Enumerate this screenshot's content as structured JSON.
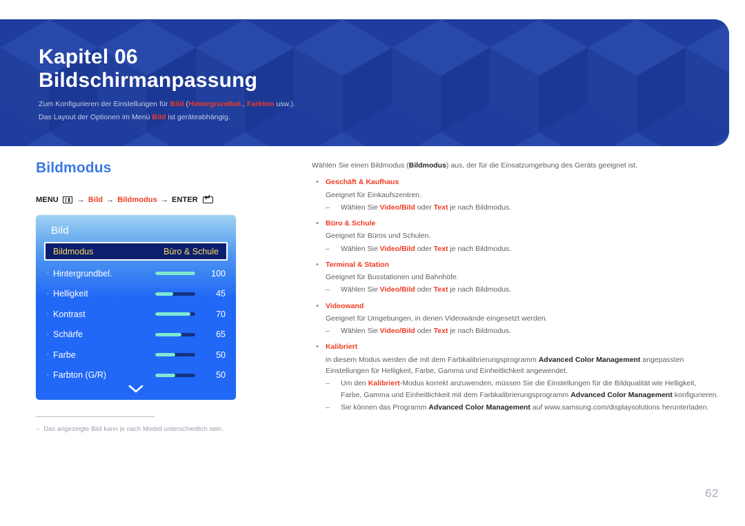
{
  "banner": {
    "chapter_label": "Kapitel 06",
    "chapter_title": "Bildschirmanpassung",
    "sub_line1_a": "Zum Konfigurieren der Einstellungen für ",
    "sub_line1_hl1": "Bild",
    "sub_line1_b": " (",
    "sub_line1_hl2": "Hintergrundbel.",
    "sub_line1_c": ", ",
    "sub_line1_hl3": "Farbton",
    "sub_line1_d": " usw.).",
    "sub_line2_a": "Das Layout der Optionen im Menü ",
    "sub_line2_hl1": "Bild",
    "sub_line2_b": " ist geräteabhängig.",
    "bg_color": "#1f3e9e",
    "accent_color": "#ef3b24"
  },
  "left": {
    "section_title": "Bildmodus",
    "menu_path": {
      "menu_label": "MENU",
      "arrow": "→",
      "item1": "Bild",
      "item2": "Bildmodus",
      "enter_label": "ENTER",
      "menu_icon": "menu-grid-icon",
      "enter_icon": "enter-key-icon"
    },
    "osd": {
      "title": "Bild",
      "selected": {
        "label": "Bildmodus",
        "value": "Büro & Schule"
      },
      "rows": [
        {
          "label": "Hintergrundbel.",
          "value": "100",
          "fill_pct": 100
        },
        {
          "label": "Helligkeit",
          "value": "45",
          "fill_pct": 45
        },
        {
          "label": "Kontrast",
          "value": "70",
          "fill_pct": 88
        },
        {
          "label": "Schärfe",
          "value": "65",
          "fill_pct": 65
        },
        {
          "label": "Farbe",
          "value": "50",
          "fill_pct": 50
        },
        {
          "label": "Farbton (G/R)",
          "value": "50",
          "fill_pct": 50
        }
      ],
      "scroll_icon": "chevron-down-icon",
      "slider_fill_color": "#7ee9d2",
      "slider_track_color": "#123483"
    },
    "footnote": {
      "dash": "–",
      "text": "Das angezeigte Bild kann je nach Modell unterschiedlich sein."
    }
  },
  "right": {
    "intro_a": "Wählen Sie einen Bildmodus (",
    "intro_hl": "Bildmodus",
    "intro_b": ") aus, der für die Einsatzumgebung des Geräts geeignet ist.",
    "bullet_char": "•",
    "dash_char": "–",
    "modes": [
      {
        "name": "Geschäft & Kaufhaus",
        "desc": "Geeignet für Einkaufszentren.",
        "sub_a": "Wählen Sie ",
        "sub_hl1": "Video/Bild",
        "sub_b": " oder ",
        "sub_hl2": "Text",
        "sub_c": " je nach Bildmodus."
      },
      {
        "name": "Büro & Schule",
        "desc": "Geeignet für Büros und Schulen.",
        "sub_a": "Wählen Sie ",
        "sub_hl1": "Video/Bild",
        "sub_b": " oder ",
        "sub_hl2": "Text",
        "sub_c": " je nach Bildmodus."
      },
      {
        "name": "Terminal & Station",
        "desc": "Geeignet für Busstationen und Bahnhöfe.",
        "sub_a": "Wählen Sie ",
        "sub_hl1": "Video/Bild",
        "sub_b": " oder ",
        "sub_hl2": "Text",
        "sub_c": " je nach Bildmodus."
      },
      {
        "name": "Videowand",
        "desc": "Geeignet für Umgebungen, in denen Videowände eingesetzt werden.",
        "sub_a": "Wählen Sie ",
        "sub_hl1": "Video/Bild",
        "sub_b": " oder ",
        "sub_hl2": "Text",
        "sub_c": " je nach Bildmodus."
      }
    ],
    "kalibriert": {
      "name": "Kalibriert",
      "desc_a": "in diesem Modus werden die mit dem Farbkalibrierungsprogramm ",
      "desc_hl": "Advanced Color Management",
      "desc_b": " angepassten Einstellungen für Helligkeit, Farbe, Gamma und Einheitlichkeit angewendet.",
      "note1_a": "Um den ",
      "note1_hl1": "Kalibriert",
      "note1_b": "-Modus korrekt anzuwenden, müssen Sie die Einstellungen für die Bildqualität wie Helligkeit, Farbe, Gamma und Einheitlichkeit mit dem Farbkalibrierungsprogramm ",
      "note1_hl2": "Advanced Color Management",
      "note1_c": " konfigurieren.",
      "note2_a": "Sie können das Programm ",
      "note2_hl": "Advanced Color Management",
      "note2_b": " auf www.samsung.com/displaysolutions herunterladen."
    }
  },
  "page_number": "62"
}
